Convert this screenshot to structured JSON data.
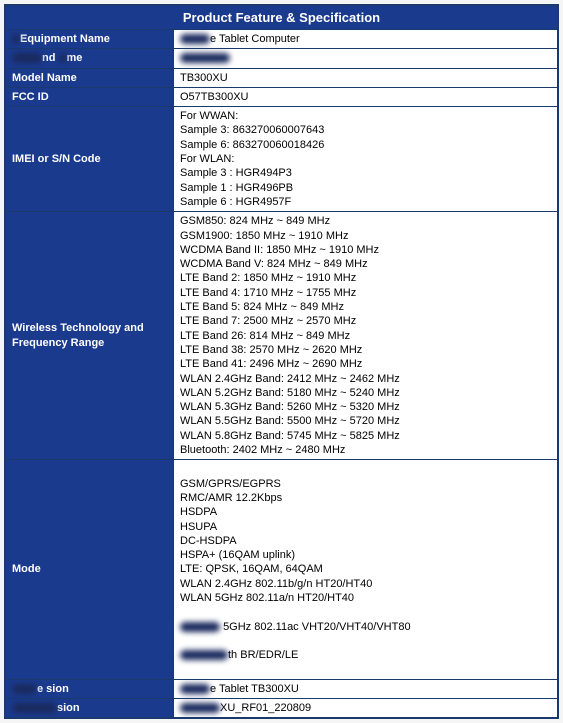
{
  "header": "Product Feature & Specification",
  "rows": {
    "equipment_name": {
      "label": "Equipment Name",
      "value": "e Tablet Computer",
      "smudge_value_prefix": true
    },
    "brand_name": {
      "label": "nd",
      "label_prefix_smudge": true,
      "label_suffix": "me",
      "value": "",
      "smudge_value_prefix": true
    },
    "model_name": {
      "label": "Model Name",
      "value": "TB300XU"
    },
    "fcc_id": {
      "label": "FCC ID",
      "value": "O57TB300XU"
    },
    "imei": {
      "label": "IMEI or S/N Code",
      "lines": [
        "For WWAN:",
        "Sample 3: 863270060007643",
        "Sample 6: 863270060018426",
        "For WLAN:",
        "Sample 3 : HGR494P3",
        "Sample 1 : HGR496PB",
        "Sample 6 : HGR4957F"
      ]
    },
    "wireless": {
      "label": "Wireless Technology and Frequency Range",
      "lines": [
        "GSM850: 824 MHz ~ 849 MHz",
        "GSM1900: 1850 MHz ~ 1910 MHz",
        "WCDMA Band II: 1850 MHz ~ 1910 MHz",
        "WCDMA Band V: 824 MHz ~ 849 MHz",
        "LTE Band 2: 1850 MHz ~ 1910 MHz",
        "LTE Band 4: 1710 MHz ~ 1755 MHz",
        "LTE Band 5: 824 MHz ~ 849 MHz",
        "LTE Band 7: 2500 MHz ~ 2570 MHz",
        "LTE Band 26: 814 MHz ~ 849 MHz",
        "LTE Band 38: 2570 MHz ~ 2620 MHz",
        "LTE Band 41: 2496 MHz ~ 2690 MHz",
        "WLAN 2.4GHz Band: 2412 MHz ~ 2462 MHz",
        "WLAN 5.2GHz Band: 5180 MHz ~ 5240 MHz",
        "WLAN 5.3GHz Band: 5260 MHz ~ 5320 MHz",
        "WLAN 5.5GHz Band: 5500 MHz ~ 5720 MHz",
        "WLAN 5.8GHz Band: 5745 MHz ~ 5825 MHz",
        "Bluetooth: 2402 MHz ~ 2480 MHz"
      ]
    },
    "mode": {
      "label": "Mode",
      "lines": [
        "GSM/GPRS/EGPRS",
        "RMC/AMR 12.2Kbps",
        "HSDPA",
        "HSUPA",
        "DC-HSDPA",
        "HSPA+ (16QAM uplink)",
        "LTE: QPSK, 16QAM, 64QAM",
        "WLAN 2.4GHz 802.11b/g/n HT20/HT40",
        "WLAN 5GHz 802.11a/n HT20/HT40"
      ],
      "partial_lines": [
        "5GHz 802.11ac VHT20/VHT40/VHT80",
        "th BR/EDR/LE"
      ]
    },
    "hw_version": {
      "label_partial": "e sion",
      "value_partial": "e Tablet TB300XU"
    },
    "sw_version": {
      "label_partial": "sion",
      "value_partial": "XU_RF01_220809"
    }
  }
}
